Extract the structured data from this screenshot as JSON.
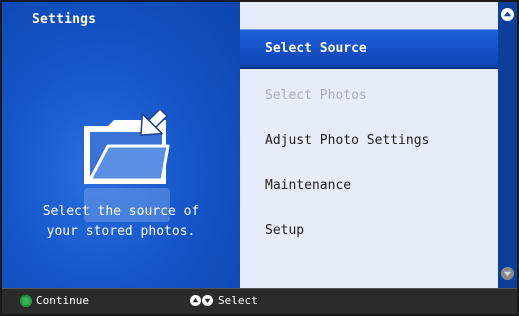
{
  "panel": {
    "title": "Settings",
    "description_line1": "Select the source of",
    "description_line2": "your stored photos."
  },
  "menu": {
    "items": [
      {
        "label": "Select Source",
        "state": "selected"
      },
      {
        "label": "Select Photos",
        "state": "disabled"
      },
      {
        "label": "Adjust Photo Settings",
        "state": "normal"
      },
      {
        "label": "Maintenance",
        "state": "normal"
      },
      {
        "label": "Setup",
        "state": "normal"
      }
    ]
  },
  "footer": {
    "continue_label": "Continue",
    "select_label": "Select",
    "continue_icon": "ok-button-icon",
    "select_icon": "up-down-arrows-icon"
  },
  "icons": {
    "main": "folder-with-arrow-icon",
    "scroll_up": "scroll-up-icon",
    "scroll_down": "scroll-down-icon"
  },
  "colors": {
    "accent": "#1656c8",
    "selected": "#0d44b4",
    "menu_bg": "#e6ecfa",
    "disabled_text": "#a8adb8",
    "ok_green": "#2fb34a"
  }
}
